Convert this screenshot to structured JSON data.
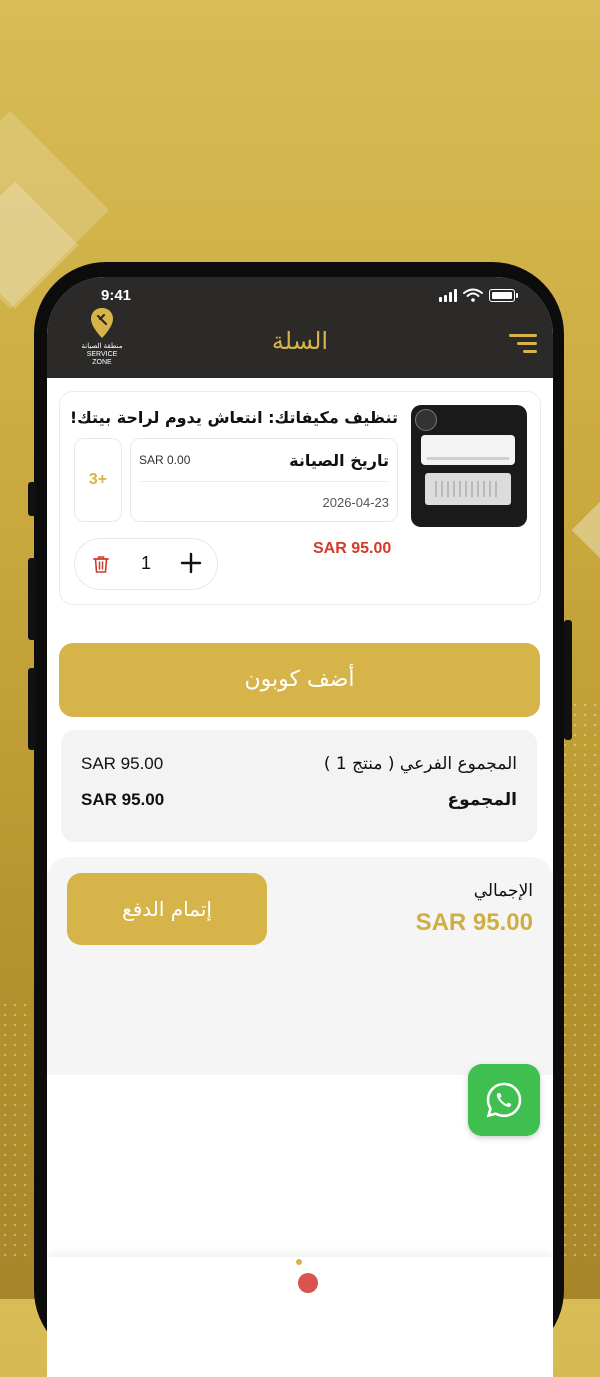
{
  "status_bar": {
    "time": "9:41"
  },
  "header": {
    "title": "السلة",
    "logo_text_ar": "منطقة الصيانة",
    "logo_text_en": "SERVICE ZONE"
  },
  "cart_item": {
    "title": "تنظيف مكيفاتك: انتعاش يدوم لراحة بيتك!",
    "maintenance_date_label": "تاريخ الصيانة",
    "maintenance_date_price": "SAR 0.00",
    "maintenance_date": "2026-04-23",
    "more_count": "3+",
    "quantity": "1",
    "price": "SAR 95.00"
  },
  "coupon": {
    "label": "أضف كوبون"
  },
  "summary": {
    "subtotal_label": "المجموع الفرعي ( منتج 1 )",
    "subtotal_value": "SAR 95.00",
    "total_label": "المجموع",
    "total_value": "SAR 95.00"
  },
  "checkout": {
    "grand_total_label": "الإجمالي",
    "grand_total_value": "SAR 95.00",
    "button_label": "إتمام الدفع"
  },
  "colors": {
    "accent": "#d6b44a",
    "header_bg": "#2b2a28",
    "price_red": "#d23a2a",
    "whatsapp": "#3fbf4f"
  },
  "icons": [
    "menu-icon",
    "trash-icon",
    "plus-icon",
    "whatsapp-icon",
    "signal-icon",
    "wifi-icon",
    "battery-icon"
  ]
}
